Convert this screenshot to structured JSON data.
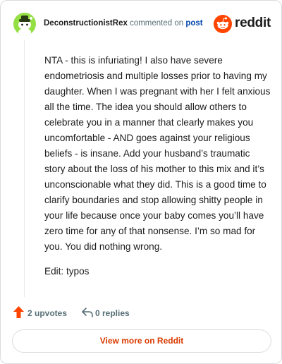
{
  "header": {
    "author": "DeconstructionistRex",
    "action_text": "commented on",
    "post_link": "post",
    "brand_name": "reddit",
    "brand_color": "#ff4500",
    "avatar_color": "#94e044",
    "avatar_icon": "snoo-avatar-icon"
  },
  "comment": {
    "paragraphs": [
      "NTA - this is infuriating! I also have severe endometriosis and multiple losses prior to having my daughter. When I was pregnant with her I felt anxious all the time. The idea you should allow others to celebrate you in a manner that clearly makes you uncomfortable - AND goes against your religious beliefs - is insane. Add your husband’s traumatic story about the loss of his mother to this mix and it’s unconscionable what they did. This is a good time to clarify boundaries and stop allowing shitty people in your life because once your baby comes you’ll have zero time for any of that nonsense. I’m so mad for you. You did nothing wrong.",
      "Edit: typos"
    ]
  },
  "actions": {
    "upvotes": "2 upvotes",
    "replies": "0 replies",
    "upvote_icon": "upvote-arrow-icon",
    "upvote_color": "#ff4500",
    "reply_icon": "reply-arrow-icon"
  },
  "footer": {
    "view_more": "View more on Reddit",
    "link_color": "#d93a00"
  }
}
